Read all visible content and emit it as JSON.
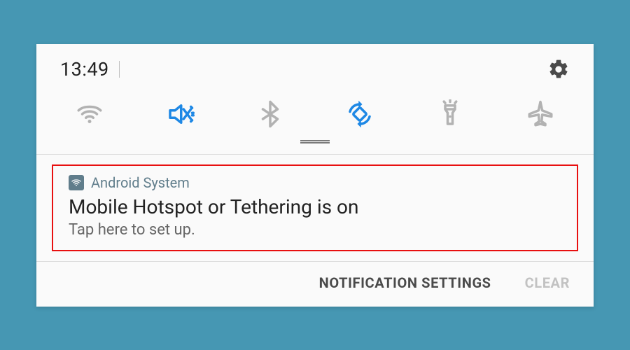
{
  "status": {
    "time": "13:49"
  },
  "quick_settings": {
    "items": [
      {
        "name": "wifi",
        "active": false
      },
      {
        "name": "sound-mute",
        "active": true
      },
      {
        "name": "bluetooth",
        "active": false
      },
      {
        "name": "auto-rotate",
        "active": true
      },
      {
        "name": "flashlight",
        "active": false
      },
      {
        "name": "airplane",
        "active": false
      }
    ]
  },
  "notification": {
    "app_name": "Android System",
    "title": "Mobile Hotspot or Tethering is on",
    "subtitle": "Tap here to set up."
  },
  "footer": {
    "settings_label": "NOTIFICATION SETTINGS",
    "clear_label": "CLEAR"
  },
  "colors": {
    "accent": "#1e88e5",
    "highlight_border": "#e81010",
    "inactive_icon": "#b2b2b2",
    "app_tint": "#607d8b"
  }
}
